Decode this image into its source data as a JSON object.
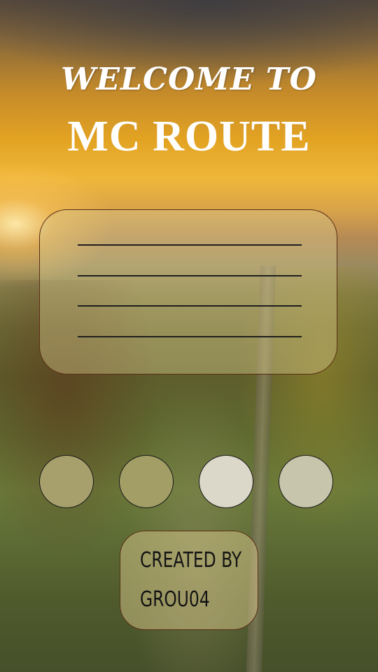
{
  "header": {
    "welcome_text": "WELCOME TO",
    "app_title": "MC ROUTE"
  },
  "form": {
    "fields": [
      "",
      "",
      "",
      ""
    ]
  },
  "buttons": {
    "circles": [
      {
        "color": "#a7a06c"
      },
      {
        "color": "#a29e66"
      },
      {
        "color": "#dbd8c9"
      },
      {
        "color": "#c8c5ad"
      }
    ]
  },
  "credit": {
    "line1": "CREATED BY",
    "line2": "GROU04"
  }
}
